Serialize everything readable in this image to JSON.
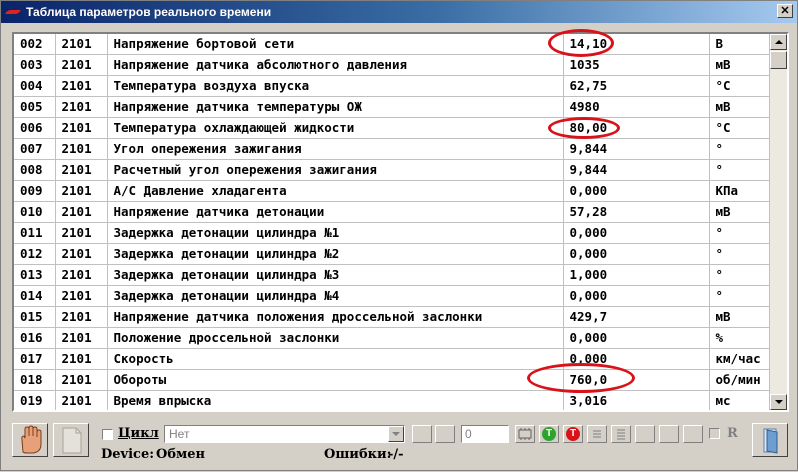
{
  "window": {
    "title": "Таблица параметров реального времени",
    "close_label": "✕"
  },
  "table": {
    "rows": [
      {
        "num": "002",
        "code": "2101",
        "name": "Напряжение бортовой сети",
        "value": "14,10",
        "unit": "В"
      },
      {
        "num": "003",
        "code": "2101",
        "name": "Напряжение датчика абсолютного давления",
        "value": "1035",
        "unit": "мВ"
      },
      {
        "num": "004",
        "code": "2101",
        "name": "Температура воздуха впуска",
        "value": "62,75",
        "unit": "°C"
      },
      {
        "num": "005",
        "code": "2101",
        "name": "Напряжение датчика температуры ОЖ",
        "value": "4980",
        "unit": "мВ"
      },
      {
        "num": "006",
        "code": "2101",
        "name": "Температура охлаждающей жидкости",
        "value": "80,00",
        "unit": "°C"
      },
      {
        "num": "007",
        "code": "2101",
        "name": "Угол опережения зажигания",
        "value": "9,844",
        "unit": "°"
      },
      {
        "num": "008",
        "code": "2101",
        "name": "Расчетный угол опережения зажигания",
        "value": "9,844",
        "unit": "°"
      },
      {
        "num": "009",
        "code": "2101",
        "name": "А/С Давление хладагента",
        "value": "0,000",
        "unit": "КПа"
      },
      {
        "num": "010",
        "code": "2101",
        "name": "Напряжение датчика детонации",
        "value": "57,28",
        "unit": "мВ"
      },
      {
        "num": "011",
        "code": "2101",
        "name": "Задержка детонации цилиндра №1",
        "value": "0,000",
        "unit": "°"
      },
      {
        "num": "012",
        "code": "2101",
        "name": "Задержка детонации цилиндра №2",
        "value": "0,000",
        "unit": "°"
      },
      {
        "num": "013",
        "code": "2101",
        "name": "Задержка детонации цилиндра №3",
        "value": "1,000",
        "unit": "°"
      },
      {
        "num": "014",
        "code": "2101",
        "name": "Задержка детонации цилиндра №4",
        "value": "0,000",
        "unit": "°"
      },
      {
        "num": "015",
        "code": "2101",
        "name": "Напряжение датчика положения дроссельной заслонки",
        "value": "429,7",
        "unit": "мВ"
      },
      {
        "num": "016",
        "code": "2101",
        "name": "Положение дроссельной заслонки",
        "value": "0,000",
        "unit": "%"
      },
      {
        "num": "017",
        "code": "2101",
        "name": "Скорость",
        "value": "0,000",
        "unit": "км/час"
      },
      {
        "num": "018",
        "code": "2101",
        "name": "Обороты",
        "value": "760,0",
        "unit": "об/мин"
      },
      {
        "num": "019",
        "code": "2101",
        "name": "Время впрыска",
        "value": "3,016",
        "unit": "мс"
      }
    ]
  },
  "toolbar": {
    "cycle_label": "Цикл",
    "select_value": "Нет",
    "number_value": "0",
    "t_green": "T",
    "t_red": "T",
    "r_label": "R"
  },
  "status": {
    "device_label": "Device:",
    "device_value": "Обмен",
    "errors_label": "Ошибки:",
    "errors_value": "-/-"
  },
  "colors": {
    "titlebar_start": "#0a246a",
    "highlight_red": "#d9121a",
    "green_t": "#2ea32e",
    "red_t": "#d9121a"
  }
}
